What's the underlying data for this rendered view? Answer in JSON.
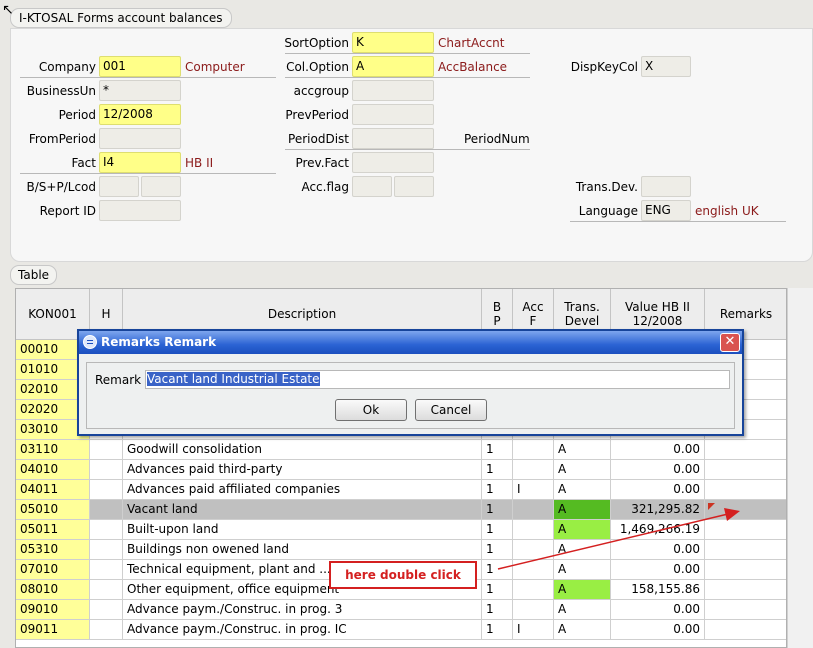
{
  "window": {
    "title": "I-KTOSAL Forms account balances"
  },
  "form": {
    "company": {
      "label": "Company",
      "value": "001",
      "desc": "Computer"
    },
    "business_un": {
      "label": "BusinessUn",
      "value": "*"
    },
    "period": {
      "label": "Period",
      "value": "12/2008"
    },
    "from_period": {
      "label": "FromPeriod",
      "value": ""
    },
    "fact": {
      "label": "Fact",
      "value": "I4",
      "desc": "HB II"
    },
    "bsp_lcod": {
      "label": "B/S+P/Lcod"
    },
    "report_id": {
      "label": "Report ID"
    },
    "sort_option": {
      "label": "SortOption",
      "value": "K",
      "desc": "ChartAccnt"
    },
    "col_option": {
      "label": "Col.Option",
      "value": "A",
      "desc": "AccBalance"
    },
    "accgroup": {
      "label": "accgroup"
    },
    "prev_period": {
      "label": "PrevPeriod"
    },
    "period_dist": {
      "label": "PeriodDist",
      "extra": "PeriodNum"
    },
    "prev_fact": {
      "label": "Prev.Fact"
    },
    "acc_flag": {
      "label": "Acc.flag"
    },
    "disp_key_col": {
      "label": "DispKeyCol",
      "value": "X"
    },
    "trans_dev": {
      "label": "Trans.Dev."
    },
    "language": {
      "label": "Language",
      "value": "ENG",
      "desc": "english UK"
    }
  },
  "table": {
    "tab_label": "Table",
    "headers": [
      "KON001",
      "H",
      "Description",
      "B\nP",
      "Acc\nF",
      "Trans.\nDevel",
      "Value HB II\n12/2008",
      "Remarks"
    ],
    "rows": [
      {
        "k": "00010",
        "h": "",
        "d": "",
        "b": "",
        "a": "",
        "t": "",
        "v": "",
        "r": ""
      },
      {
        "k": "01010",
        "h": "",
        "d": "",
        "b": "",
        "a": "",
        "t": "",
        "v": "",
        "r": ""
      },
      {
        "k": "02010",
        "h": "",
        "d": "",
        "b": "",
        "a": "",
        "t": "",
        "v": "",
        "r": ""
      },
      {
        "k": "02020",
        "h": "",
        "d": "",
        "b": "",
        "a": "",
        "t": "",
        "v": "",
        "r": ""
      },
      {
        "k": "03010",
        "h": "",
        "d": "",
        "b": "",
        "a": "",
        "t": "",
        "v": "",
        "r": ""
      },
      {
        "k": "03110",
        "h": "",
        "d": "Goodwill consolidation",
        "b": "1",
        "a": "",
        "t": "A",
        "v": "0.00",
        "r": ""
      },
      {
        "k": "04010",
        "h": "",
        "d": "Advances paid third-party",
        "b": "1",
        "a": "",
        "t": "A",
        "v": "0.00",
        "r": ""
      },
      {
        "k": "04011",
        "h": "",
        "d": "Advances paid affiliated companies",
        "b": "1",
        "a": "I",
        "t": "A",
        "v": "0.00",
        "r": ""
      },
      {
        "k": "05010",
        "h": "",
        "d": "Vacant land",
        "b": "1",
        "a": "",
        "t": "A",
        "v": "321,295.82",
        "r": "",
        "sel": true,
        "green": true
      },
      {
        "k": "05011",
        "h": "",
        "d": "Built-upon land",
        "b": "1",
        "a": "",
        "t": "A",
        "v": "1,469,266.19",
        "r": "",
        "green": true
      },
      {
        "k": "05310",
        "h": "",
        "d": "Buildings non owened land",
        "b": "1",
        "a": "",
        "t": "A",
        "v": "0.00",
        "r": ""
      },
      {
        "k": "07010",
        "h": "",
        "d": "Technical equipment, plant and ...",
        "b": "1",
        "a": "",
        "t": "A",
        "v": "0.00",
        "r": ""
      },
      {
        "k": "08010",
        "h": "",
        "d": "Other equipment, office equipment",
        "b": "1",
        "a": "",
        "t": "A",
        "v": "158,155.86",
        "r": "",
        "green": true
      },
      {
        "k": "09010",
        "h": "",
        "d": "Advance paym./Construc. in prog. 3",
        "b": "1",
        "a": "",
        "t": "A",
        "v": "0.00",
        "r": ""
      },
      {
        "k": "09011",
        "h": "",
        "d": "Advance paym./Construc. in prog. IC",
        "b": "1",
        "a": "I",
        "t": "A",
        "v": "0.00",
        "r": ""
      }
    ]
  },
  "dialog": {
    "title": "Remarks Remark",
    "field_label": "Remark",
    "field_value": "Vacant land Industrial Estate",
    "ok_label": "Ok",
    "cancel_label": "Cancel"
  },
  "annotation": {
    "text": "here double click"
  },
  "colors": {
    "field_yellow": "#ffff88",
    "desc_red": "#8b1a1a",
    "dialog_blue": "#2b63d3",
    "trans_green": "#99ee44",
    "callout_red": "#d42020"
  }
}
